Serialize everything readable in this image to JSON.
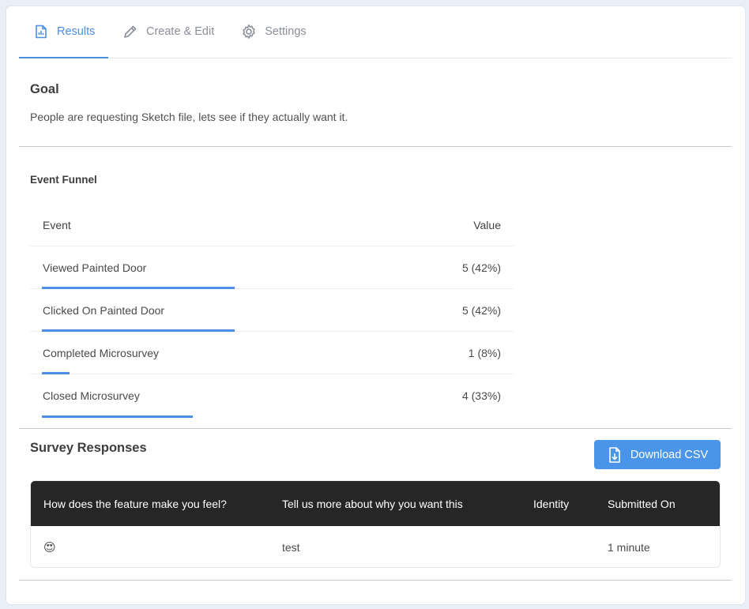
{
  "tabs": [
    {
      "label": "Results",
      "icon": "report-icon",
      "active": true
    },
    {
      "label": "Create & Edit",
      "icon": "pencil-icon",
      "active": false
    },
    {
      "label": "Settings",
      "icon": "gear-icon",
      "active": false
    }
  ],
  "goal": {
    "title": "Goal",
    "text": "People are requesting Sketch file, lets see if they actually want it."
  },
  "funnel": {
    "title": "Event Funnel",
    "col_event": "Event",
    "col_value": "Value",
    "rows": [
      {
        "event": "Viewed Painted Door",
        "value": "5 (42%)",
        "fraction": 0.42
      },
      {
        "event": "Clicked On Painted Door",
        "value": "5 (42%)",
        "fraction": 0.42
      },
      {
        "event": "Completed Microsurvey",
        "value": "1 (8%)",
        "fraction": 0.06
      },
      {
        "event": "Closed Microsurvey",
        "value": "4 (33%)",
        "fraction": 0.33
      }
    ]
  },
  "survey": {
    "title": "Survey Responses",
    "download_label": "Download CSV",
    "headers": [
      "How does the feature make you feel?",
      "Tell us more about why you want this",
      "Identity",
      "Submitted On"
    ],
    "rows": [
      {
        "feel": "😍",
        "why": "test",
        "identity": "",
        "submitted": "1 minute"
      }
    ]
  },
  "colors": {
    "accent": "#4a8fe3",
    "table_header": "#262626"
  }
}
